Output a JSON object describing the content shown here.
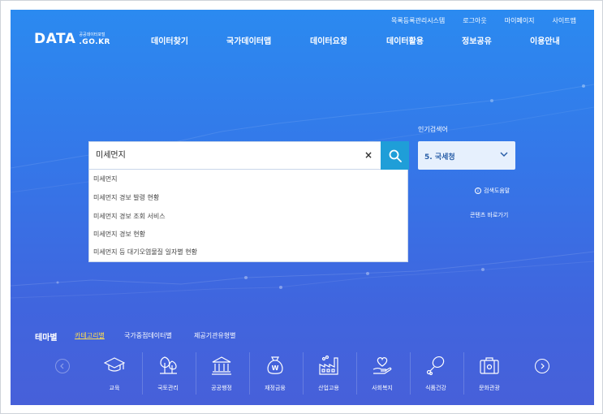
{
  "utility_nav": [
    "목록등록관리시스템",
    "로그아웃",
    "마이페이지",
    "사이트맵"
  ],
  "logo": {
    "main": "DATA",
    "sub_small": "공공데이터포털",
    "sub_domain": ".GO.KR"
  },
  "gnb": [
    "데이터찾기",
    "국가데이터맵",
    "데이터요청",
    "데이터활용",
    "정보공유",
    "이용안내"
  ],
  "search": {
    "value": "미세먼지",
    "clear": "×"
  },
  "autocomplete": [
    "미세먼지",
    "미세먼지 경보 발령 현황",
    "미세먼지 경보 조회 서비스",
    "미세먼지 경보 현황",
    "미세먼지 등 대기오염물질 일자별 현황"
  ],
  "popular": {
    "label": "인기검색어",
    "selected": "5. 국세청"
  },
  "help_link": "검색도움말",
  "shortcut_link": "콘텐츠 바로가기",
  "theme": {
    "title": "테마별",
    "tabs": [
      "카테고리별",
      "국가중점데이터별",
      "제공기관유형별"
    ],
    "categories": [
      "교육",
      "국토관리",
      "공공행정",
      "재정금융",
      "산업고용",
      "사회복지",
      "식품건강",
      "문화관광"
    ]
  },
  "colors": {
    "accent": "#1f9ed8",
    "active_tab": "#ffdf4e",
    "hero_top": "#2b8af0",
    "hero_bottom": "#4760d9"
  }
}
